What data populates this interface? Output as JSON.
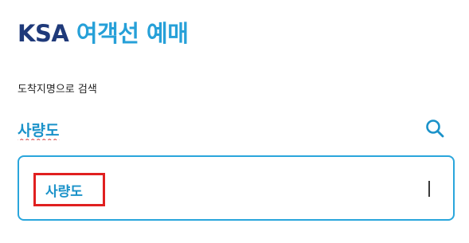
{
  "header": {
    "brand": "KSA",
    "title": "여객선 예매",
    "brand_color": "#1f3a7a",
    "title_color": "#26a0d8"
  },
  "search": {
    "label": "도착지명으로 검색",
    "value": "사량도",
    "icon": "search-icon"
  },
  "results": {
    "items": [
      {
        "label": "사량도",
        "highlighted": true
      }
    ],
    "accent_color": "#2aa6dc",
    "highlight_color": "#e02020"
  }
}
